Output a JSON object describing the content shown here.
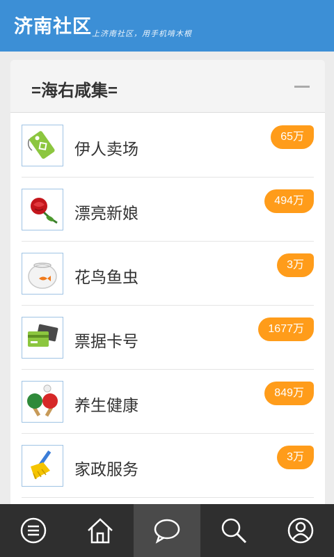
{
  "header": {
    "title": "济南社区",
    "tagline": "上济南社区，用手机啃木根",
    "bg_color": "#3c8fd6"
  },
  "section": {
    "title": "=海右咸集=",
    "collapse_icon": "minus-icon"
  },
  "items": [
    {
      "label": "伊人卖场",
      "count": "65万",
      "icon": "shopping-tag-icon"
    },
    {
      "label": "漂亮新娘",
      "count": "494万",
      "icon": "rose-icon"
    },
    {
      "label": "花鸟鱼虫",
      "count": "3万",
      "icon": "fishbowl-icon"
    },
    {
      "label": "票据卡号",
      "count": "1677万",
      "icon": "cards-icon"
    },
    {
      "label": "养生健康",
      "count": "849万",
      "icon": "ping-pong-icon"
    },
    {
      "label": "家政服务",
      "count": "3万",
      "icon": "broom-icon"
    }
  ],
  "tabbar": {
    "tabs": [
      {
        "icon": "menu-icon",
        "active": false
      },
      {
        "icon": "home-icon",
        "active": false
      },
      {
        "icon": "chat-bubble-icon",
        "active": true
      },
      {
        "icon": "search-icon",
        "active": false
      },
      {
        "icon": "user-icon",
        "active": false
      }
    ]
  },
  "colors": {
    "accent": "#ff9c1a",
    "tabbar": "#2f2f2f"
  }
}
